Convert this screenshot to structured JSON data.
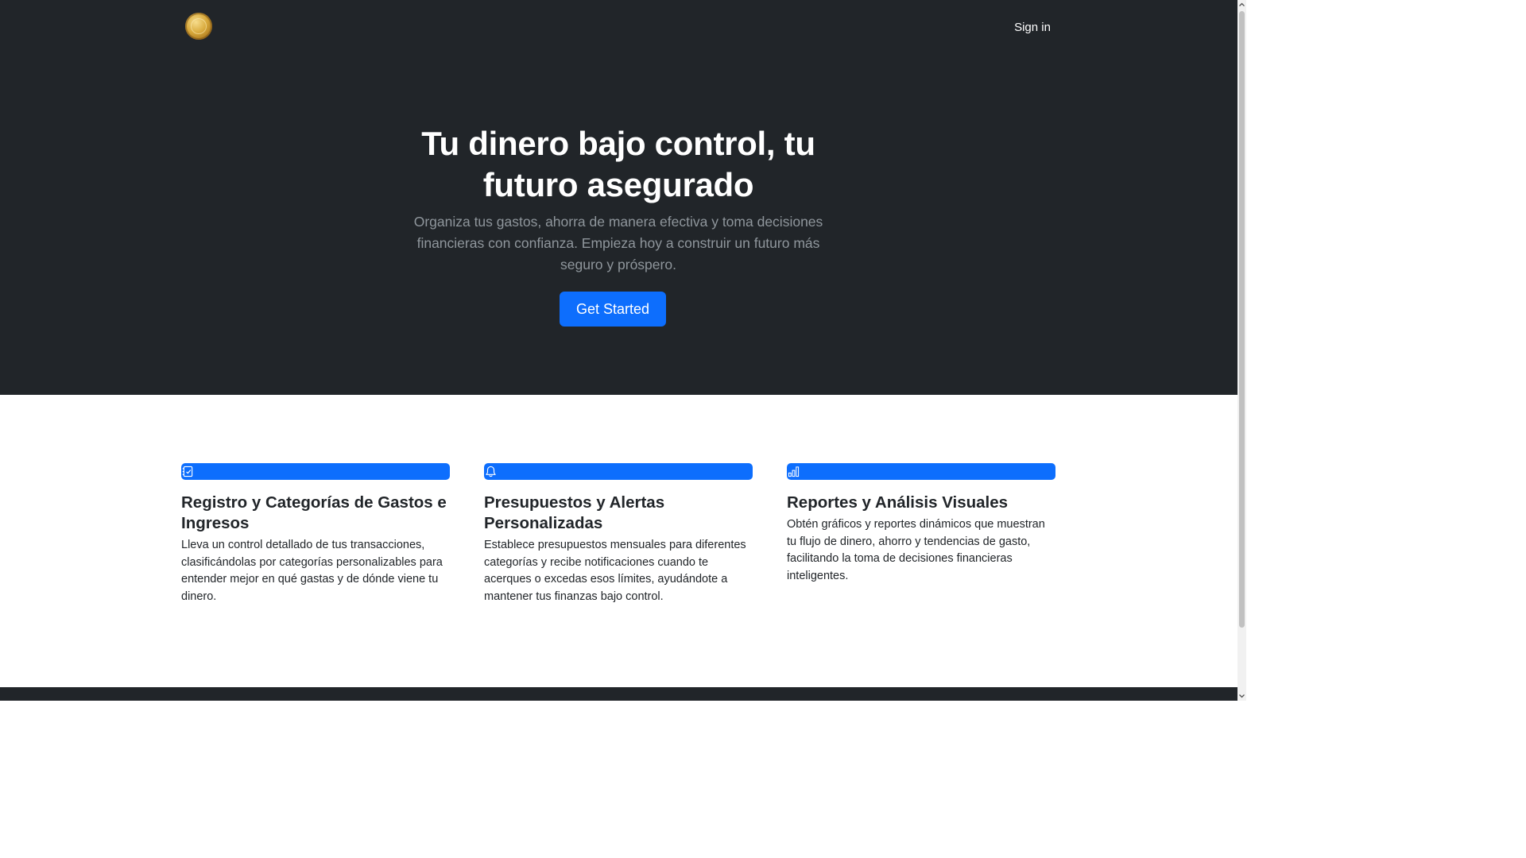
{
  "header": {
    "logo_icon": "gold-coin-icon",
    "signin_label": "Sign in"
  },
  "hero": {
    "title": "Tu dinero bajo control, tu futuro asegurado",
    "subtitle": "Organiza tus gastos, ahorra de manera efectiva y toma decisiones financieras con confianza. Empieza hoy a construir un futuro más seguro y próspero.",
    "cta_label": "Get Started"
  },
  "features": [
    {
      "icon": "checklist-icon",
      "title": "Registro y Categorías de Gastos e Ingresos",
      "text": "Lleva un control detallado de tus transacciones, clasificándolas por categorías personalizables para entender mejor en qué gastas y de dónde viene tu dinero."
    },
    {
      "icon": "bell-icon",
      "title": "Presupuestos y Alertas Personalizadas",
      "text": "Establece presupuestos mensuales para diferentes categorías y recibe notificaciones cuando te acerques o excedas esos límites, ayudándote a mantener tus finanzas bajo control."
    },
    {
      "icon": "bar-chart-icon",
      "title": "Reportes y Análisis Visuales",
      "text": "Obtén gráficos y reportes dinámicos que muestran tu flujo de dinero, ahorro y tendencias de gasto, facilitando la toma de decisiones financieras inteligentes."
    }
  ],
  "colors": {
    "hero_bg": "#212529",
    "accent": "#0d6efd",
    "muted_text": "#8f969c"
  }
}
